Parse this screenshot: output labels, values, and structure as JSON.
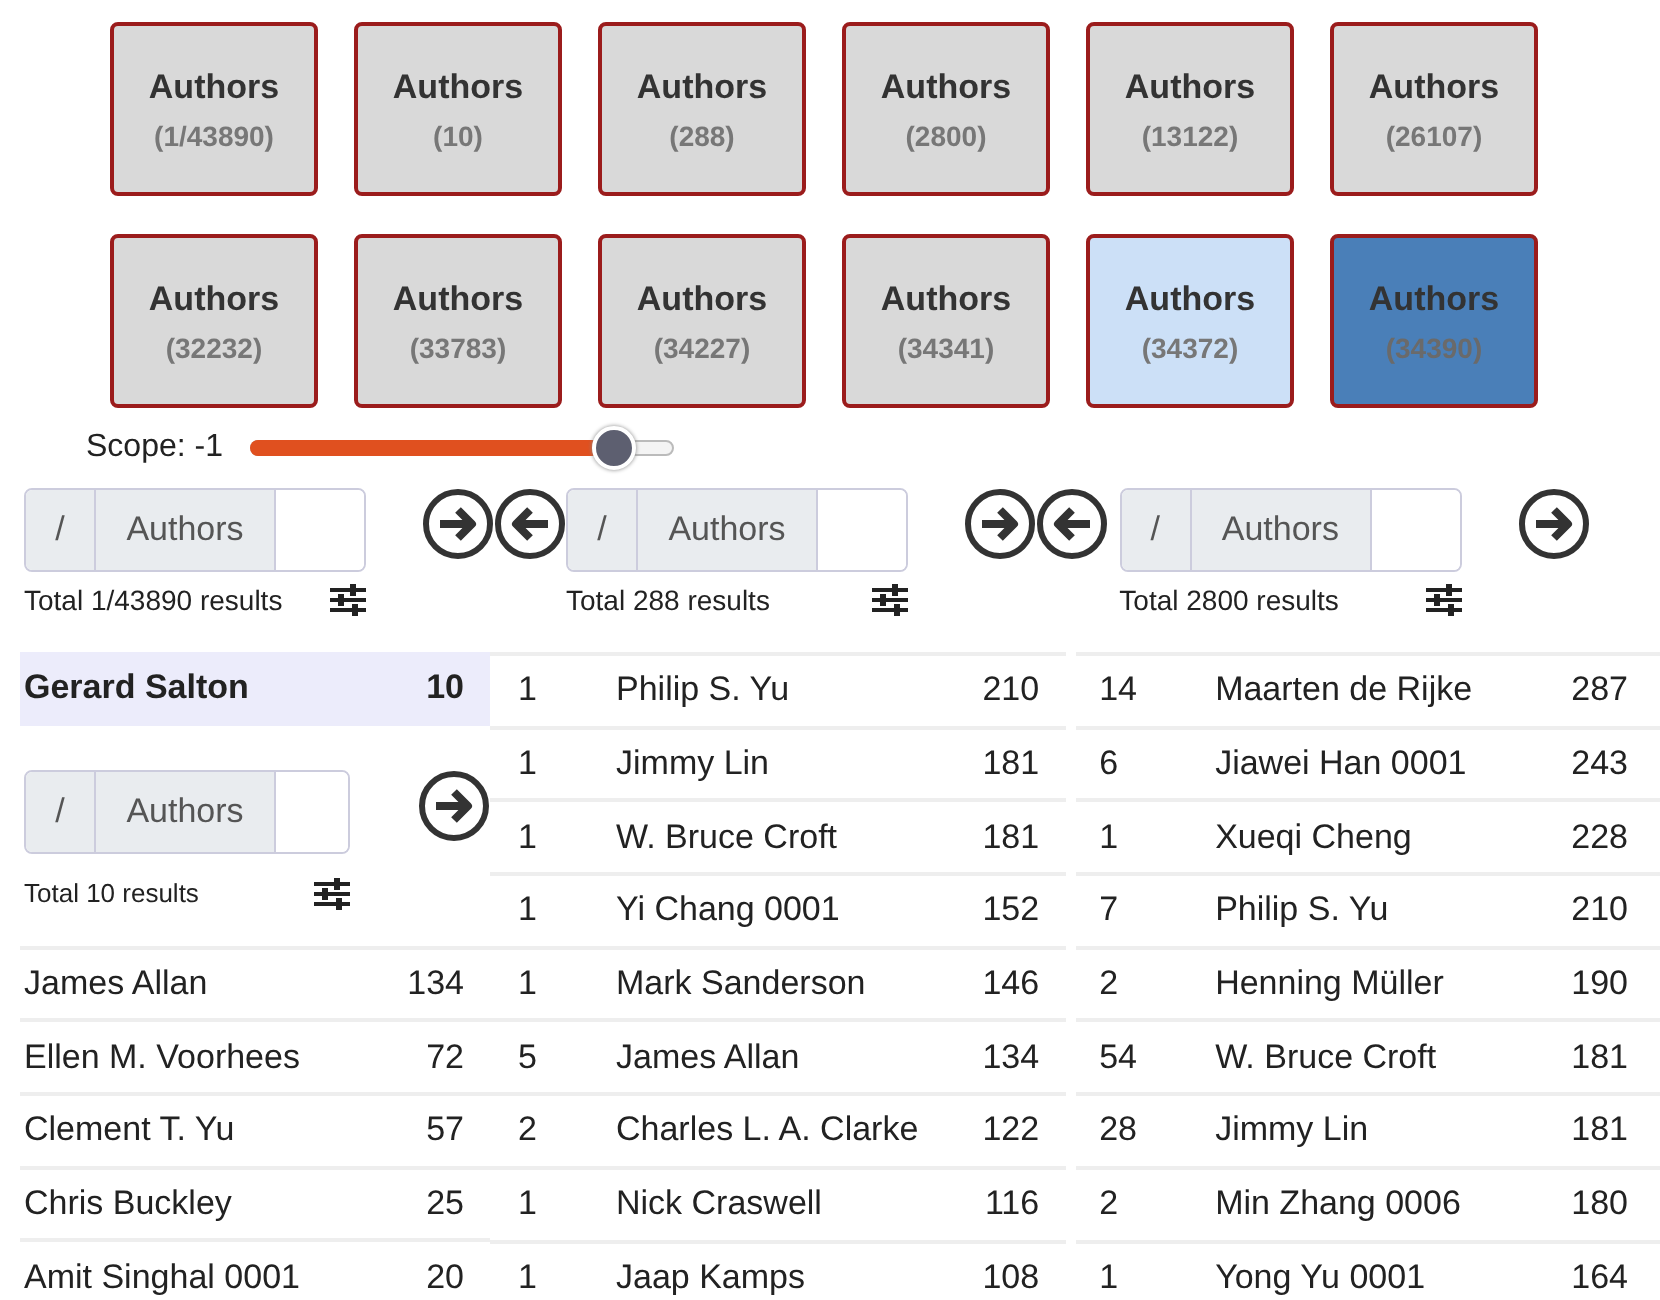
{
  "button_rows": [
    {
      "buttons": [
        {
          "label": "Authors",
          "count": "(1/43890)",
          "selected": false,
          "highlighted": false
        },
        {
          "label": "Authors",
          "count": "(10)",
          "selected": false,
          "highlighted": false
        },
        {
          "label": "Authors",
          "count": "(288)",
          "selected": false,
          "highlighted": false
        },
        {
          "label": "Authors",
          "count": "(2800)",
          "selected": false,
          "highlighted": false
        },
        {
          "label": "Authors",
          "count": "(13122)",
          "selected": false,
          "highlighted": false
        },
        {
          "label": "Authors",
          "count": "(26107)",
          "selected": false,
          "highlighted": false
        }
      ]
    },
    {
      "buttons": [
        {
          "label": "Authors",
          "count": "(32232)",
          "selected": false,
          "highlighted": false
        },
        {
          "label": "Authors",
          "count": "(33783)",
          "selected": false,
          "highlighted": false
        },
        {
          "label": "Authors",
          "count": "(34227)",
          "selected": false,
          "highlighted": false
        },
        {
          "label": "Authors",
          "count": "(34341)",
          "selected": false,
          "highlighted": false
        },
        {
          "label": "Authors",
          "count": "(34372)",
          "selected": false,
          "highlighted": true
        },
        {
          "label": "Authors",
          "count": "(34390)",
          "selected": true,
          "highlighted": false
        }
      ]
    }
  ],
  "scope": {
    "label": "Scope: -1",
    "level": 0.86
  },
  "search_panels": [
    {
      "prefix": "/",
      "facet": "Authors",
      "total": "Total 1/43890 results",
      "arrows": [
        {
          "kind": "right"
        },
        {
          "kind": "left"
        }
      ]
    },
    {
      "prefix": "/",
      "facet": "Authors",
      "total": "Total 288 results",
      "arrows": [
        {
          "kind": "right"
        },
        {
          "kind": "left"
        }
      ]
    },
    {
      "prefix": "/",
      "facet": "Authors",
      "total": "Total 2800 results",
      "arrows": [
        {
          "kind": "right"
        }
      ]
    }
  ],
  "result_columns": [
    {
      "items": [
        {
          "kind": "row",
          "name": "Gerard Salton",
          "value": "10",
          "selected": true
        },
        {
          "kind": "search",
          "prefix": "/",
          "facet": "Authors",
          "total": "Total 10 results",
          "arrows": [
            {
              "kind": "right"
            }
          ]
        },
        {
          "kind": "row",
          "name": "James Allan",
          "value": "134",
          "selected": false
        },
        {
          "kind": "row",
          "name": "Ellen M. Voorhees",
          "value": "72",
          "selected": false
        },
        {
          "kind": "row",
          "name": "Clement T. Yu",
          "value": "57",
          "selected": false
        },
        {
          "kind": "row",
          "name": "Chris Buckley",
          "value": "25",
          "selected": false
        },
        {
          "kind": "row",
          "name": "Amit Singhal 0001",
          "value": "20",
          "selected": false
        }
      ]
    },
    {
      "items": [
        {
          "kind": "row",
          "count": "1",
          "name": "Philip S. Yu",
          "value": "210",
          "selected": false
        },
        {
          "kind": "row",
          "count": "1",
          "name": "Jimmy Lin",
          "value": "181",
          "selected": false
        },
        {
          "kind": "row",
          "count": "1",
          "name": "W. Bruce Croft",
          "value": "181",
          "selected": false
        },
        {
          "kind": "row",
          "count": "1",
          "name": "Yi Chang 0001",
          "value": "152",
          "selected": false
        },
        {
          "kind": "row",
          "count": "1",
          "name": "Mark Sanderson",
          "value": "146",
          "selected": false
        },
        {
          "kind": "row",
          "count": "5",
          "name": "James Allan",
          "value": "134",
          "selected": false
        },
        {
          "kind": "row",
          "count": "2",
          "name": "Charles L. A. Clarke",
          "value": "122",
          "selected": false
        },
        {
          "kind": "row",
          "count": "1",
          "name": "Nick Craswell",
          "value": "116",
          "selected": false
        },
        {
          "kind": "row",
          "count": "1",
          "name": "Jaap Kamps",
          "value": "108",
          "selected": false
        }
      ]
    },
    {
      "items": [
        {
          "kind": "row",
          "count": "14",
          "name": "Maarten de Rijke",
          "value": "287",
          "selected": false
        },
        {
          "kind": "row",
          "count": "6",
          "name": "Jiawei Han 0001",
          "value": "243",
          "selected": false
        },
        {
          "kind": "row",
          "count": "1",
          "name": "Xueqi Cheng",
          "value": "228",
          "selected": false
        },
        {
          "kind": "row",
          "count": "7",
          "name": "Philip S. Yu",
          "value": "210",
          "selected": false
        },
        {
          "kind": "row",
          "count": "2",
          "name": "Henning Müller",
          "value": "190",
          "selected": false
        },
        {
          "kind": "row",
          "count": "54",
          "name": "W. Bruce Croft",
          "value": "181",
          "selected": false
        },
        {
          "kind": "row",
          "count": "28",
          "name": "Jimmy Lin",
          "value": "181",
          "selected": false
        },
        {
          "kind": "row",
          "count": "2",
          "name": "Min Zhang 0006",
          "value": "180",
          "selected": false
        },
        {
          "kind": "row",
          "count": "1",
          "name": "Yong Yu 0001",
          "value": "164",
          "selected": false
        }
      ]
    }
  ]
}
